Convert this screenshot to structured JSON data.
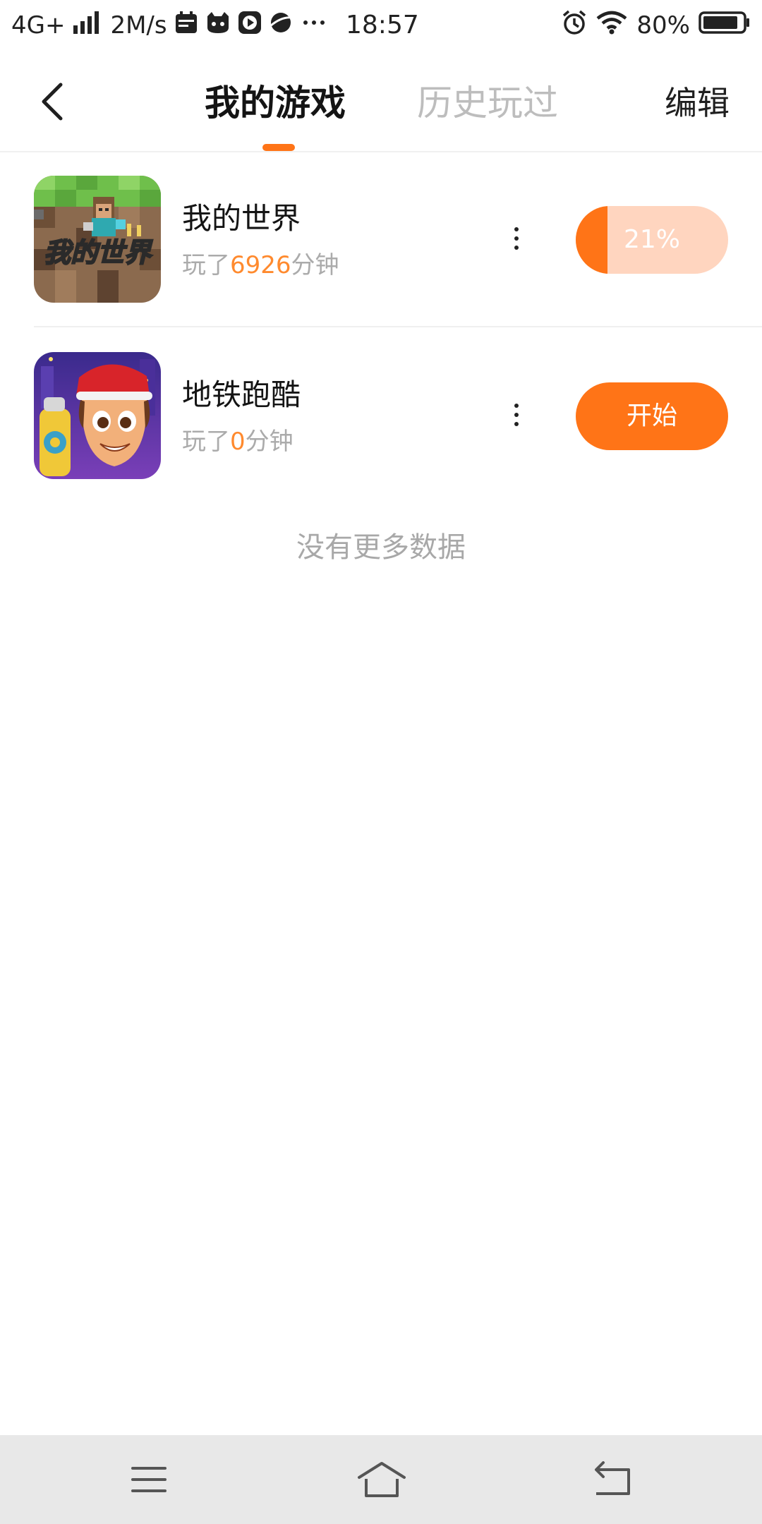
{
  "status_bar": {
    "network": "4G+",
    "speed": "2M/s",
    "time": "18:57",
    "battery": "80%",
    "icons_left": [
      "signal-icon",
      "calendar-icon",
      "cat-app-icon",
      "play-app-icon",
      "browser-app-icon",
      "more-dots-icon"
    ],
    "icons_right": [
      "alarm-icon",
      "wifi-icon",
      "battery-icon"
    ]
  },
  "header": {
    "tabs": [
      {
        "label": "我的游戏",
        "active": true
      },
      {
        "label": "历史玩过",
        "active": false
      }
    ],
    "edit_label": "编辑",
    "accent_color": "#ff7417"
  },
  "games": [
    {
      "name": "我的世界",
      "time_prefix": "玩了",
      "minutes": "6926",
      "time_suffix": "分钟",
      "action_type": "progress",
      "progress_text": "21%",
      "progress": 0.21,
      "icon_name": "minecraft-icon",
      "icon_text": "我的世界"
    },
    {
      "name": "地铁跑酷",
      "time_prefix": "玩了",
      "minutes": "0",
      "time_suffix": "分钟",
      "action_type": "start",
      "action_label": "开始",
      "icon_name": "subway-surfers-icon"
    }
  ],
  "footer_text": "没有更多数据",
  "system_nav": [
    "menu-icon",
    "home-icon",
    "back-icon"
  ]
}
